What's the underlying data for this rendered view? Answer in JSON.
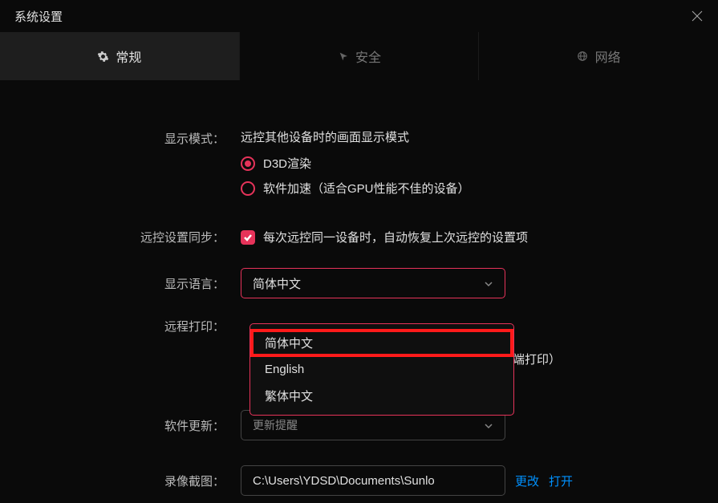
{
  "window": {
    "title": "系统设置"
  },
  "tabs": {
    "general": "常规",
    "security": "安全",
    "network": "网络"
  },
  "settings": {
    "display_mode": {
      "label": "显示模式：",
      "desc": "远控其他设备时的画面显示模式",
      "option_d3d": "D3D渲染",
      "option_software": "软件加速（适合GPU性能不佳的设备）"
    },
    "sync": {
      "label": "远控设置同步：",
      "text": "每次远控同一设备时，自动恢复上次远控的设置项"
    },
    "language": {
      "label": "显示语言：",
      "selected": "简体中文",
      "options": {
        "zh_cn": "简体中文",
        "en": "English",
        "zh_tw": "繁体中文"
      }
    },
    "remote_print": {
      "label": "远程打印：",
      "tail_text": "端打印）"
    },
    "update": {
      "label": "软件更新：",
      "selected_dim": "更新提醒"
    },
    "recording": {
      "label": "录像截图：",
      "path": "C:\\Users\\YDSD\\Documents\\Sunlo",
      "change": "更改",
      "open": "打开"
    }
  }
}
